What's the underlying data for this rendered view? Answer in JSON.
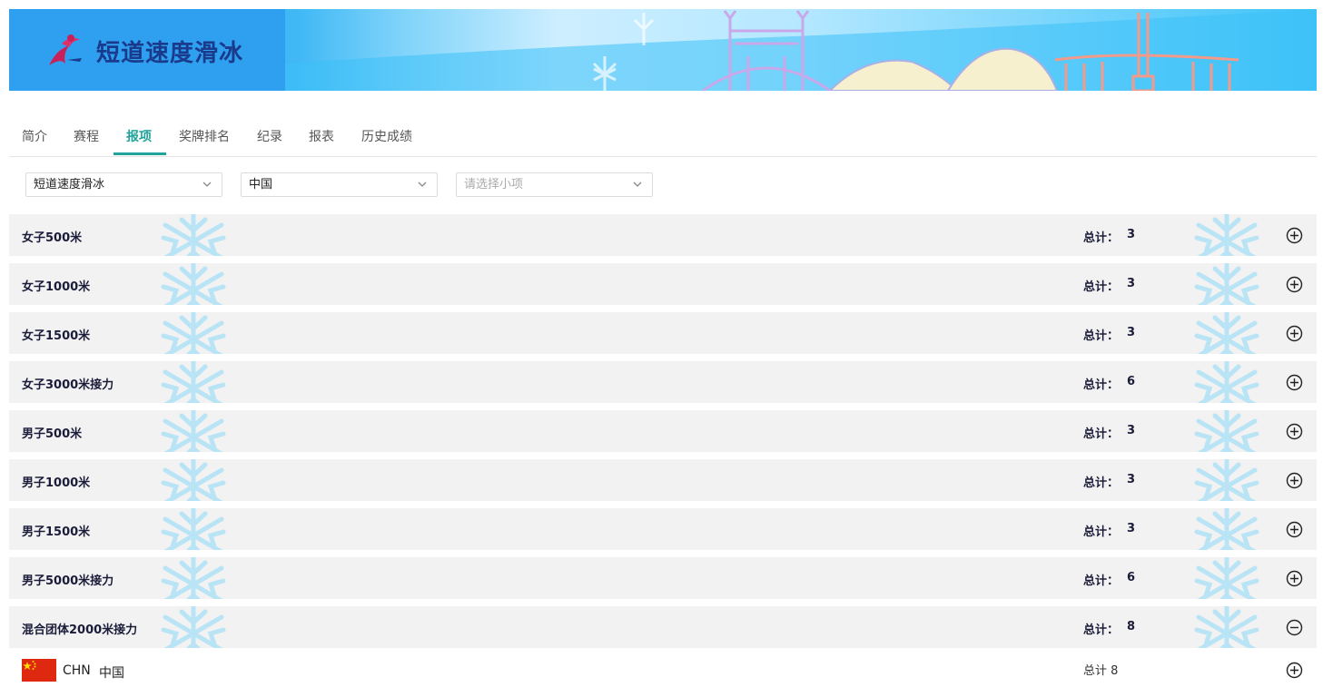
{
  "banner": {
    "title": "短道速度滑冰"
  },
  "tabs": [
    {
      "label": "简介"
    },
    {
      "label": "赛程"
    },
    {
      "label": "报项",
      "active": true
    },
    {
      "label": "奖牌排名"
    },
    {
      "label": "纪录"
    },
    {
      "label": "报表"
    },
    {
      "label": "历史成绩"
    }
  ],
  "filters": {
    "sport": "短道速度滑冰",
    "country": "中国",
    "event_placeholder": "请选择小项"
  },
  "events": [
    {
      "name": "女子500米",
      "total_label": "总计：",
      "total": "3",
      "expanded": false
    },
    {
      "name": "女子1000米",
      "total_label": "总计：",
      "total": "3",
      "expanded": false
    },
    {
      "name": "女子1500米",
      "total_label": "总计：",
      "total": "3",
      "expanded": false
    },
    {
      "name": "女子3000米接力",
      "total_label": "总计：",
      "total": "6",
      "expanded": false
    },
    {
      "name": "男子500米",
      "total_label": "总计：",
      "total": "3",
      "expanded": false
    },
    {
      "name": "男子1000米",
      "total_label": "总计：",
      "total": "3",
      "expanded": false
    },
    {
      "name": "男子1500米",
      "total_label": "总计：",
      "total": "3",
      "expanded": false
    },
    {
      "name": "男子5000米接力",
      "total_label": "总计：",
      "total": "6",
      "expanded": false
    },
    {
      "name": "混合团体2000米接力",
      "total_label": "总计：",
      "total": "8",
      "expanded": true
    }
  ],
  "country_row": {
    "code": "CHN",
    "name": "中国",
    "total": "总计 8"
  },
  "colors": {
    "accent": "#1fa39a",
    "row_bg": "#f2f2f2",
    "snowflake": "#b9e4f5",
    "flag_red": "#de2910",
    "flag_star": "#ffde00"
  },
  "icons": {
    "expand": "plus-circle-icon",
    "collapse": "minus-circle-icon",
    "dropdown": "chevron-down-icon"
  }
}
